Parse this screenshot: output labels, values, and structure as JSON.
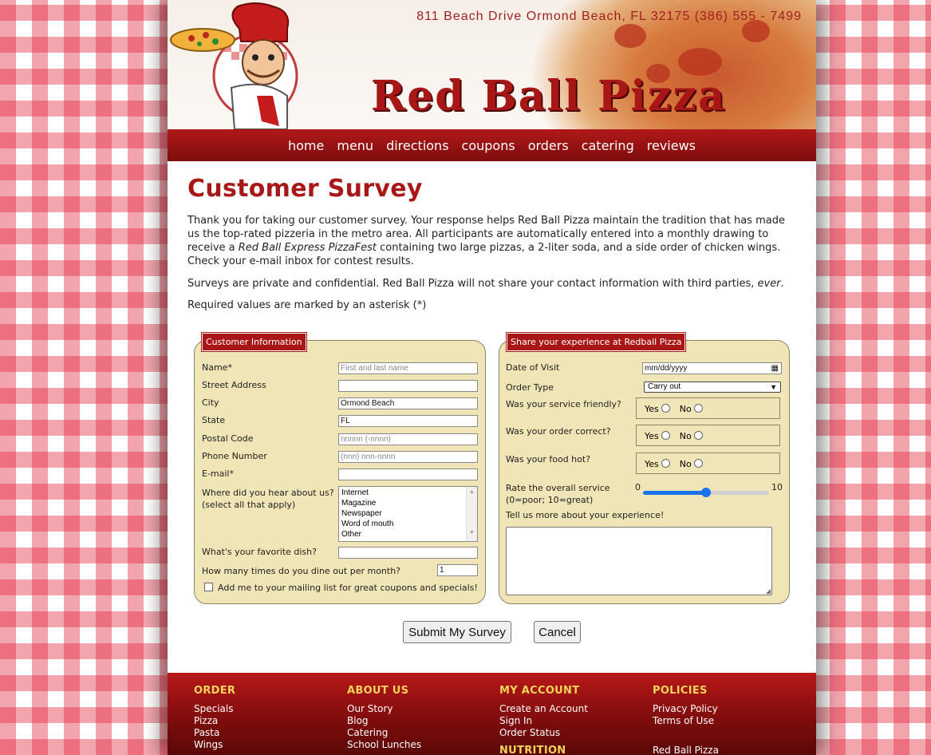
{
  "header": {
    "address": "811 Beach Drive  Ormond Beach, FL 32175   (386) 555 - 7499",
    "logo_text": "Red Ball Pizza"
  },
  "nav": [
    "home",
    "menu",
    "directions",
    "coupons",
    "orders",
    "catering",
    "reviews"
  ],
  "page": {
    "title": "Customer Survey",
    "intro_a": "Thank you for taking our customer survey. Your response helps Red Ball Pizza maintain the tradition that has made us the top-rated pizzeria in the metro area. All participants are automatically entered into a monthly drawing to receive a ",
    "intro_em": "Red Ball Express PizzaFest",
    "intro_b": " containing two large pizzas, a 2-liter soda, and a side order of chicken wings. Check your e-mail inbox for contest results.",
    "privacy_a": "Surveys are private and confidential. Red Ball Pizza will not share your contact information with third parties, ",
    "privacy_em": "ever",
    "privacy_b": ".",
    "required_note": "Required values are marked by an asterisk (*)"
  },
  "customer": {
    "legend": "Customer Information",
    "name_label": "Name*",
    "name_placeholder": "First and last name",
    "street_label": "Street Address",
    "city_label": "City",
    "city_value": "Ormond Beach",
    "state_label": "State",
    "state_value": "FL",
    "postal_label": "Postal Code",
    "postal_placeholder": "nnnnn (-nnnn)",
    "phone_label": "Phone Number",
    "phone_placeholder": "(nnn) nnn-nnnn",
    "email_label": "E-mail*",
    "hear_label_1": "Where did you hear about us?",
    "hear_label_2": "(select all that apply)",
    "hear_options": [
      "Internet",
      "Magazine",
      "Newspaper",
      "Word of mouth",
      "Other"
    ],
    "dish_label": "What's your favorite dish?",
    "dine_label": "How many times do you dine out per month?",
    "dine_value": "1",
    "mailing_label": "Add me to your mailing list for great coupons and specials!"
  },
  "experience": {
    "legend": "Share your experience at Redball Pizza",
    "date_label": "Date of Visit",
    "date_placeholder": "mm/dd/yyyy",
    "order_type_label": "Order Type",
    "order_type_value": "Carry out",
    "q_friendly": "Was your service friendly?",
    "q_correct": "Was your order correct?",
    "q_hot": "Was your food hot?",
    "yes": "Yes",
    "no": "No",
    "rate_label_1": "Rate the overall service",
    "rate_label_2": "(0=poor; 10=great)",
    "rate_min": "0",
    "rate_max": "10",
    "rate_value": 5,
    "tell_label": "Tell us more about your experience!"
  },
  "buttons": {
    "submit": "Submit My Survey",
    "cancel": "Cancel"
  },
  "footer": {
    "order_head": "ORDER",
    "order_links": [
      "Specials",
      "Pizza",
      "Pasta",
      "Wings"
    ],
    "about_head": "ABOUT US",
    "about_links": [
      "Our Story",
      "Blog",
      "Catering",
      "School Lunches"
    ],
    "account_head": "MY ACCOUNT",
    "account_links": [
      "Create an Account",
      "Sign In",
      "Order Status"
    ],
    "nutrition_head": "NUTRITION",
    "policies_head": "POLICIES",
    "policies_links": [
      "Privacy Policy",
      "Terms of Use"
    ],
    "brand": "Red Ball Pizza"
  },
  "colors": {
    "brand_red": "#a81616",
    "fieldset_bg": "#efe5b6",
    "footer_heading": "#f3d45a"
  }
}
